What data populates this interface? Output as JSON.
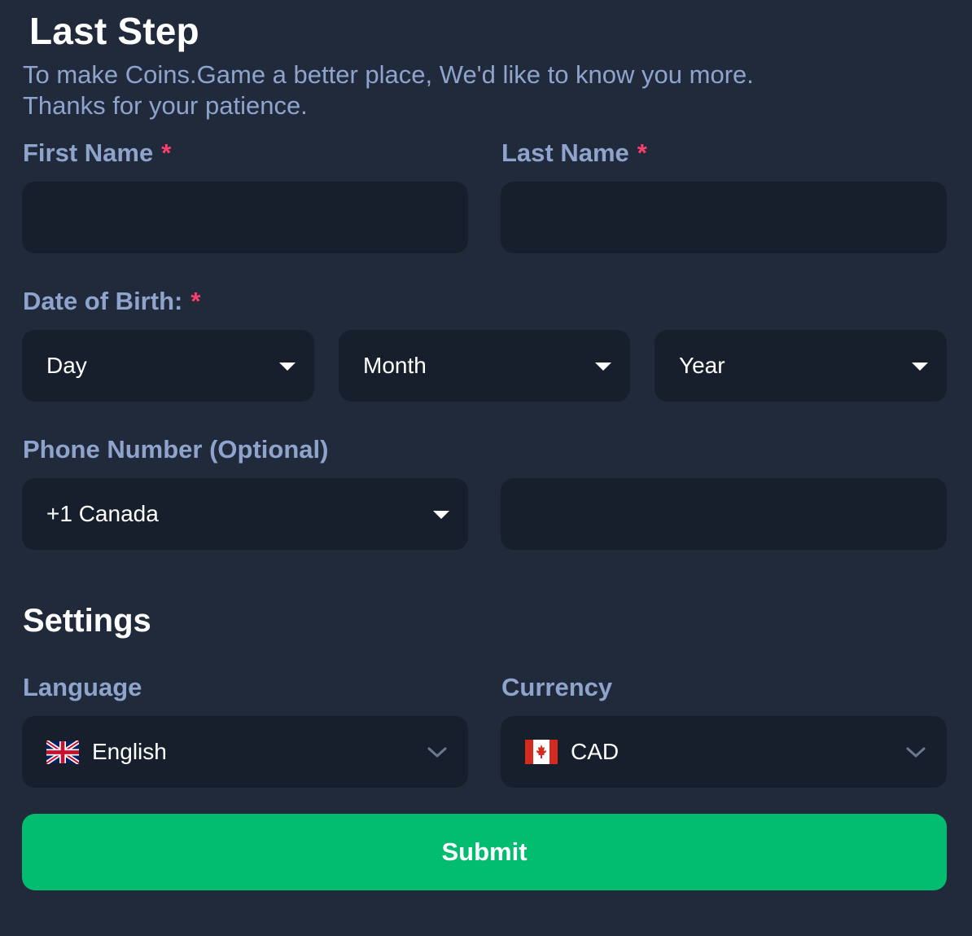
{
  "title": "Last Step",
  "subtitle": {
    "line1": "To make Coins.Game a better place, We'd like to know you more.",
    "line2": "Thanks for your patience."
  },
  "required_marker": "*",
  "first_name": {
    "label": "First Name",
    "value": ""
  },
  "last_name": {
    "label": "Last Name",
    "value": ""
  },
  "dob": {
    "label": "Date of Birth:",
    "day": "Day",
    "month": "Month",
    "year": "Year"
  },
  "phone": {
    "label": "Phone Number (Optional)",
    "country_code": "+1 Canada",
    "number": ""
  },
  "settings": {
    "heading": "Settings",
    "language": {
      "label": "Language",
      "value": "English",
      "flag": "uk-flag-icon"
    },
    "currency": {
      "label": "Currency",
      "value": "CAD",
      "flag": "canada-flag-icon"
    }
  },
  "submit_label": "Submit",
  "colors": {
    "background": "#212a3b",
    "field": "#171f2d",
    "label": "#8ea4cd",
    "required": "#ff3d6e",
    "accent": "#02bc70"
  }
}
